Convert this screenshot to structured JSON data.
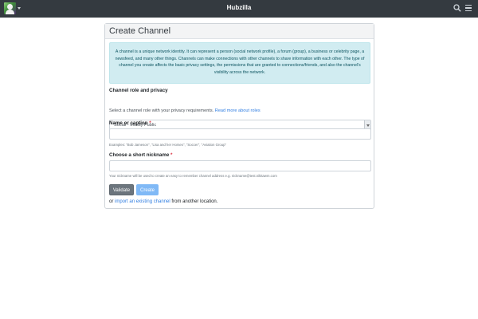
{
  "navbar": {
    "brand": "Hubzilla",
    "avatar_icon": "user-avatar-icon",
    "caret_icon": "caret-down-icon",
    "search_icon": "search-icon",
    "menu_icon": "hamburger-menu-icon",
    "background": "#343a40"
  },
  "card": {
    "title": "Create Channel",
    "info_text": "A channel is a unique network identity. It can represent a person (social network profile), a forum (group), a business or celebrity page, a newsfeed, and many other things. Channels can make connections with other channels to share information with each other. The type of channel you create affects the basic privacy settings, the permissions that are granted to connections/friends, and also the channel's visibility across the network."
  },
  "role": {
    "label": "Channel role and privacy",
    "selected": "Social - Mostly Public",
    "help_text": "Select a channel role with your privacy requirements.",
    "help_link": "Read more about roles"
  },
  "name": {
    "label": "Name or caption",
    "required_mark": "*",
    "value": "",
    "help": "Examples: \"Bob Jameson\", \"Lisa and her Horses\", \"Soccer\", \"Aviation Group\""
  },
  "nickname": {
    "label": "Choose a short nickname",
    "required_mark": "*",
    "value": "",
    "help": "Your nickname will be used to create an easy to remember channel address e.g. nickname@test.nikitawm.com"
  },
  "buttons": {
    "validate": "Validate",
    "create": "Create"
  },
  "import": {
    "prefix": "or",
    "link": "import an existing channel",
    "suffix": "from another location."
  },
  "colors": {
    "info_bg": "#d1ecf1",
    "info_text": "#0c5460",
    "link": "#2f7de1",
    "required": "#dc3545",
    "validate_bg": "#6c757d",
    "create_bg": "#80b9f6"
  }
}
